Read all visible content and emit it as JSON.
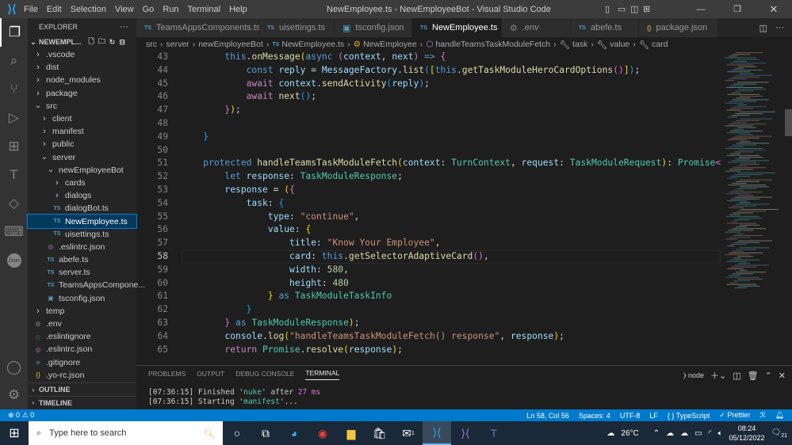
{
  "titlebar": {
    "menu": [
      "File",
      "Edit",
      "Selection",
      "View",
      "Go",
      "Run",
      "Terminal",
      "Help"
    ],
    "title": "NewEmployee.ts - NewEmployeeBot - Visual Studio Code"
  },
  "sidebar": {
    "header": "EXPLORER",
    "root": "NEWEMPL...",
    "items": [
      {
        "label": ".vscode",
        "depth": 0,
        "kind": "folder"
      },
      {
        "label": "dist",
        "depth": 0,
        "kind": "folder"
      },
      {
        "label": "node_modules",
        "depth": 0,
        "kind": "folder"
      },
      {
        "label": "package",
        "depth": 0,
        "kind": "folder"
      },
      {
        "label": "src",
        "depth": 0,
        "kind": "open"
      },
      {
        "label": "client",
        "depth": 1,
        "kind": "folder"
      },
      {
        "label": "manifest",
        "depth": 1,
        "kind": "folder"
      },
      {
        "label": "public",
        "depth": 1,
        "kind": "folder"
      },
      {
        "label": "server",
        "depth": 1,
        "kind": "open"
      },
      {
        "label": "newEmployeeBot",
        "depth": 2,
        "kind": "open"
      },
      {
        "label": "cards",
        "depth": 3,
        "kind": "folder"
      },
      {
        "label": "dialogs",
        "depth": 3,
        "kind": "folder"
      },
      {
        "label": "dialogBot.ts",
        "depth": 3,
        "kind": "ts"
      },
      {
        "label": "NewEmployee.ts",
        "depth": 3,
        "kind": "ts",
        "selected": true
      },
      {
        "label": "uisettings.ts",
        "depth": 3,
        "kind": "ts"
      },
      {
        "label": ".eslintrc.json",
        "depth": 2,
        "kind": "eslint"
      },
      {
        "label": "abefe.ts",
        "depth": 2,
        "kind": "ts"
      },
      {
        "label": "server.ts",
        "depth": 2,
        "kind": "ts"
      },
      {
        "label": "TeamsAppsCompone...",
        "depth": 2,
        "kind": "ts"
      },
      {
        "label": "tsconfig.json",
        "depth": 2,
        "kind": "tsconfig"
      },
      {
        "label": "temp",
        "depth": 0,
        "kind": "folder"
      },
      {
        "label": ".env",
        "depth": 0,
        "kind": "gear"
      },
      {
        "label": ".eslintignore",
        "depth": 0,
        "kind": "ignore"
      },
      {
        "label": ".eslintrc.json",
        "depth": 0,
        "kind": "eslint"
      },
      {
        "label": ".gitignore",
        "depth": 0,
        "kind": "git"
      },
      {
        "label": ".yo-rc.json",
        "depth": 0,
        "kind": "json"
      }
    ],
    "outline": "OUTLINE",
    "timeline": "TIMELINE"
  },
  "tabs": [
    {
      "label": "TeamsAppsComponents.ts",
      "kind": "ts"
    },
    {
      "label": "uisettings.ts",
      "kind": "ts"
    },
    {
      "label": "tsconfig.json",
      "kind": "tsconfig"
    },
    {
      "label": "NewEmployee.ts",
      "kind": "ts",
      "active": true
    },
    {
      "label": ".env",
      "kind": "gear"
    },
    {
      "label": "abefe.ts",
      "kind": "ts"
    },
    {
      "label": "package.json",
      "kind": "json"
    }
  ],
  "breadcrumb": [
    "src",
    "server",
    "newEmployeeBot",
    "NewEmployee.ts",
    "NewEmployee",
    "handleTeamsTaskModuleFetch",
    "task",
    "value",
    "card"
  ],
  "editor": {
    "current_line": 58,
    "lines": [
      {
        "n": 43,
        "t": [
          [
            "",
            "        "
          ],
          [
            "k",
            "this"
          ],
          [
            "",
            "."
          ],
          [
            "f",
            "onMessage"
          ],
          [
            "b1",
            "("
          ],
          [
            "k",
            "async"
          ],
          [
            "b2",
            " ("
          ],
          [
            "v",
            "context"
          ],
          [
            "",
            ", "
          ],
          [
            "v",
            "next"
          ],
          [
            "b2",
            ")"
          ],
          [
            "k",
            " =>"
          ],
          [
            "b2",
            " {"
          ]
        ]
      },
      {
        "n": 44,
        "t": [
          [
            "",
            "            "
          ],
          [
            "k",
            "const"
          ],
          [
            "v",
            " reply"
          ],
          [
            "",
            " = "
          ],
          [
            "v",
            "MessageFactory"
          ],
          [
            "",
            "."
          ],
          [
            "f",
            "list"
          ],
          [
            "b3",
            "("
          ],
          [
            "b1",
            "["
          ],
          [
            "k",
            "this"
          ],
          [
            "",
            "."
          ],
          [
            "f",
            "getTaskModuleHeroCardOptions"
          ],
          [
            "b2",
            "()"
          ],
          [
            "b1",
            "]"
          ],
          [
            "b3",
            ")"
          ],
          [
            "",
            ";"
          ]
        ]
      },
      {
        "n": 45,
        "t": [
          [
            "",
            "            "
          ],
          [
            "c",
            "await"
          ],
          [
            "v",
            " context"
          ],
          [
            "",
            "."
          ],
          [
            "f",
            "sendActivity"
          ],
          [
            "b3",
            "("
          ],
          [
            "v",
            "reply"
          ],
          [
            "b3",
            ")"
          ],
          [
            "",
            ";"
          ]
        ]
      },
      {
        "n": 46,
        "t": [
          [
            "",
            "            "
          ],
          [
            "c",
            "await"
          ],
          [
            "f",
            " next"
          ],
          [
            "b3",
            "()"
          ],
          [
            "",
            ";"
          ]
        ]
      },
      {
        "n": 47,
        "t": [
          [
            "",
            "        "
          ],
          [
            "b2",
            "}"
          ],
          [
            "b1",
            ")"
          ],
          [
            "",
            ";"
          ]
        ]
      },
      {
        "n": 48,
        "t": []
      },
      {
        "n": 49,
        "t": [
          [
            "",
            "    "
          ],
          [
            "b3",
            "}"
          ]
        ]
      },
      {
        "n": 50,
        "t": []
      },
      {
        "n": 51,
        "t": [
          [
            "",
            "    "
          ],
          [
            "k",
            "protected"
          ],
          [
            "f",
            " handleTeamsTaskModuleFetch"
          ],
          [
            "b1",
            "("
          ],
          [
            "v",
            "context"
          ],
          [
            "",
            ": "
          ],
          [
            "t",
            "TurnContext"
          ],
          [
            "",
            ", "
          ],
          [
            "v",
            "request"
          ],
          [
            "",
            ": "
          ],
          [
            "t",
            "TaskModuleRequest"
          ],
          [
            "b1",
            ")"
          ],
          [
            "",
            ": "
          ],
          [
            "t",
            "Promise"
          ],
          [
            "b2",
            "<"
          ]
        ]
      },
      {
        "n": 52,
        "t": [
          [
            "",
            "        "
          ],
          [
            "k",
            "let"
          ],
          [
            "v",
            " response"
          ],
          [
            "",
            ": "
          ],
          [
            "t",
            "TaskModuleResponse"
          ],
          [
            "",
            ";"
          ]
        ]
      },
      {
        "n": 53,
        "t": [
          [
            "",
            "        "
          ],
          [
            "v",
            "response"
          ],
          [
            "",
            " = "
          ],
          [
            "b1",
            "("
          ],
          [
            "b2",
            "{"
          ]
        ]
      },
      {
        "n": 54,
        "t": [
          [
            "",
            "            "
          ],
          [
            "v",
            "task"
          ],
          [
            "",
            ": "
          ],
          [
            "b3",
            "{"
          ]
        ]
      },
      {
        "n": 55,
        "t": [
          [
            "",
            "                "
          ],
          [
            "v",
            "type"
          ],
          [
            "",
            ": "
          ],
          [
            "s",
            "\"continue\""
          ],
          [
            "",
            ","
          ]
        ]
      },
      {
        "n": 56,
        "t": [
          [
            "",
            "                "
          ],
          [
            "v",
            "value"
          ],
          [
            "",
            ": "
          ],
          [
            "b1",
            "{"
          ]
        ]
      },
      {
        "n": 57,
        "t": [
          [
            "",
            "                    "
          ],
          [
            "v",
            "title"
          ],
          [
            "",
            ": "
          ],
          [
            "s",
            "\"Know Your Employee\""
          ],
          [
            "",
            ","
          ]
        ]
      },
      {
        "n": 58,
        "t": [
          [
            "",
            "                    "
          ],
          [
            "v",
            "card"
          ],
          [
            "",
            ": "
          ],
          [
            "k",
            "this"
          ],
          [
            "",
            "."
          ],
          [
            "f",
            "getSelectorAdaptiveCard"
          ],
          [
            "b2",
            "()"
          ],
          [
            "",
            ","
          ]
        ]
      },
      {
        "n": 59,
        "t": [
          [
            "",
            "                    "
          ],
          [
            "v",
            "width"
          ],
          [
            "",
            ": "
          ],
          [
            "n",
            "580"
          ],
          [
            "",
            ","
          ]
        ]
      },
      {
        "n": 60,
        "t": [
          [
            "",
            "                    "
          ],
          [
            "v",
            "height"
          ],
          [
            "",
            ": "
          ],
          [
            "n",
            "480"
          ]
        ]
      },
      {
        "n": 61,
        "t": [
          [
            "",
            "                "
          ],
          [
            "b1",
            "}"
          ],
          [
            "k",
            " as"
          ],
          [
            "t",
            " TaskModuleTaskInfo"
          ]
        ]
      },
      {
        "n": 62,
        "t": [
          [
            "",
            "            "
          ],
          [
            "b3",
            "}"
          ]
        ]
      },
      {
        "n": 63,
        "t": [
          [
            "",
            "        "
          ],
          [
            "b2",
            "}"
          ],
          [
            "k",
            " as"
          ],
          [
            "t",
            " TaskModuleResponse"
          ],
          [
            "b1",
            ")"
          ],
          [
            "",
            ";"
          ]
        ]
      },
      {
        "n": 64,
        "t": [
          [
            "",
            "        "
          ],
          [
            "v",
            "console"
          ],
          [
            "",
            "."
          ],
          [
            "f",
            "log"
          ],
          [
            "b1",
            "("
          ],
          [
            "s",
            "\"handleTeamsTaskModuleFetch() response\""
          ],
          [
            "",
            ", "
          ],
          [
            "v",
            "response"
          ],
          [
            "b1",
            ")"
          ],
          [
            "",
            ";"
          ]
        ]
      },
      {
        "n": 65,
        "t": [
          [
            "",
            "        "
          ],
          [
            "c",
            "return"
          ],
          [
            "t",
            " Promise"
          ],
          [
            "",
            "."
          ],
          [
            "f",
            "resolve"
          ],
          [
            "b1",
            "("
          ],
          [
            "v",
            "response"
          ],
          [
            "b1",
            ")"
          ],
          [
            "",
            ";"
          ]
        ]
      }
    ]
  },
  "panel": {
    "tabs": [
      "PROBLEMS",
      "OUTPUT",
      "DEBUG CONSOLE",
      "TERMINAL"
    ],
    "active": "TERMINAL",
    "shell": "node",
    "terminal": [
      [
        [
          "",
          "[07:36:15] Finished '"
        ],
        [
          "t",
          "nuke"
        ],
        [
          "",
          "' after "
        ],
        [
          "b2",
          "27 ms"
        ]
      ],
      [
        [
          "",
          "[07:36:15] Starting '"
        ],
        [
          "t",
          "manifest"
        ],
        [
          "",
          "'..."
        ]
      ]
    ]
  },
  "status": {
    "errors": "0",
    "warnings": "0",
    "position": "Ln 58, Col 56",
    "spaces": "Spaces: 4",
    "encoding": "UTF-8",
    "eol": "LF",
    "language": "TypeScript",
    "formatter": "Prettier"
  },
  "taskbar": {
    "search_placeholder": "Type here to search",
    "weather": "26°C",
    "time": "08:24",
    "date": "05/12/2022",
    "notifications": "21",
    "mail_badge": "1"
  }
}
